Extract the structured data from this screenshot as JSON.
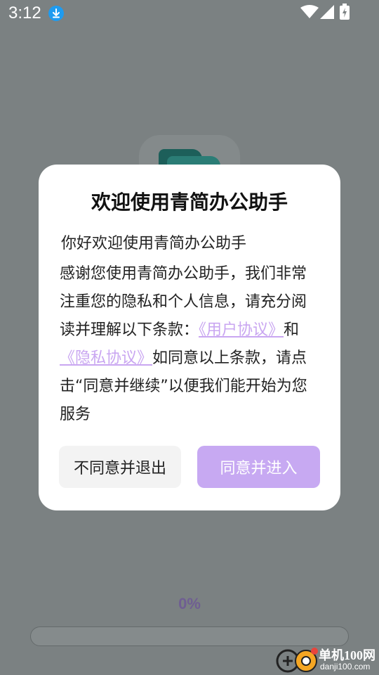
{
  "status_bar": {
    "time": "3:12",
    "icons": [
      "download-icon",
      "wifi-icon",
      "signal-icon",
      "battery-charging-icon"
    ]
  },
  "dialog": {
    "title": "欢迎使用青简办公助手",
    "greeting": "你好欢迎使用青简办公助手",
    "body_intro": "感谢您使用青简办公助手，我们非常注重您的隐私和个人信息，请充分阅读并理解以下条款：",
    "user_agreement_link": "《用户协议》",
    "conjunction": "和",
    "privacy_policy_link": "《隐私协议》",
    "body_outro": "如同意以上条款，请点击“同意并继续”以便我们能开始为您服务",
    "decline_button": "不同意并退出",
    "accept_button": "同意并进入"
  },
  "progress": {
    "label": "0%",
    "value": 0
  },
  "watermark": {
    "title": "单机100网",
    "subtitle": "danji100.com"
  },
  "colors": {
    "accent": "#c7a9f2",
    "link": "#c9a6f1",
    "overlay": "#7b8182",
    "progress_text": "#6f5e92"
  }
}
